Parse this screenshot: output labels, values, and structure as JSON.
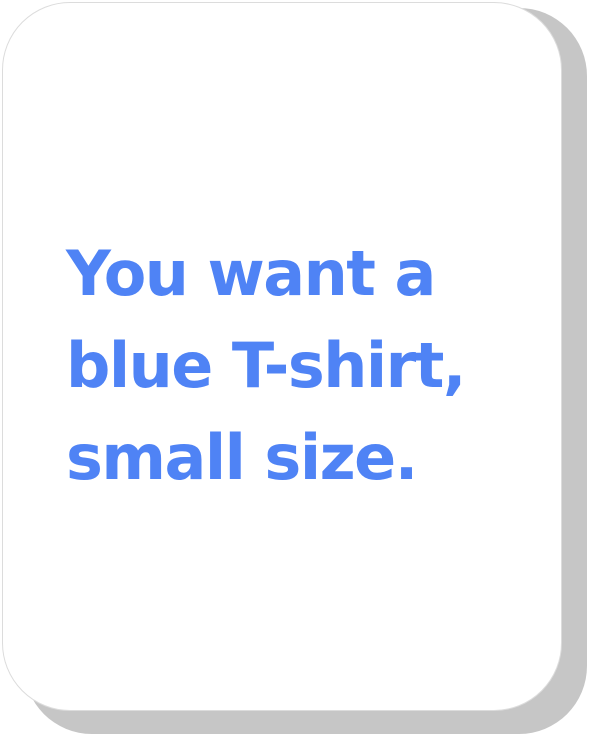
{
  "card": {
    "lines": [
      "You want a",
      "blue T-shirt,",
      "small size."
    ]
  },
  "colors": {
    "text": "#4f83f5",
    "card_background": "#ffffff",
    "shadow": "#c6c6c6"
  }
}
